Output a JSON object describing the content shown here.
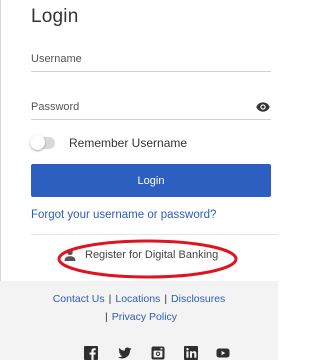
{
  "login": {
    "title": "Login",
    "username_placeholder": "Username",
    "password_placeholder": "Password",
    "remember_label": "Remember Username",
    "remember_checked": false,
    "submit_label": "Login",
    "forgot_link": "Forgot your username or password?"
  },
  "register": {
    "label": "Register for Digital Banking",
    "icon": "person-icon"
  },
  "footer": {
    "contact": "Contact Us",
    "locations": "Locations",
    "disclosures": "Disclosures",
    "privacy": "Privacy Policy",
    "separator": "|",
    "social_icons": [
      "facebook-icon",
      "twitter-icon",
      "instagram-icon",
      "linkedin-icon",
      "youtube-icon"
    ]
  },
  "colors": {
    "primary": "#2c5fbf",
    "link": "#2d5cb8",
    "annotation": "#e0141e",
    "footer_bg": "#f3f3f3"
  }
}
